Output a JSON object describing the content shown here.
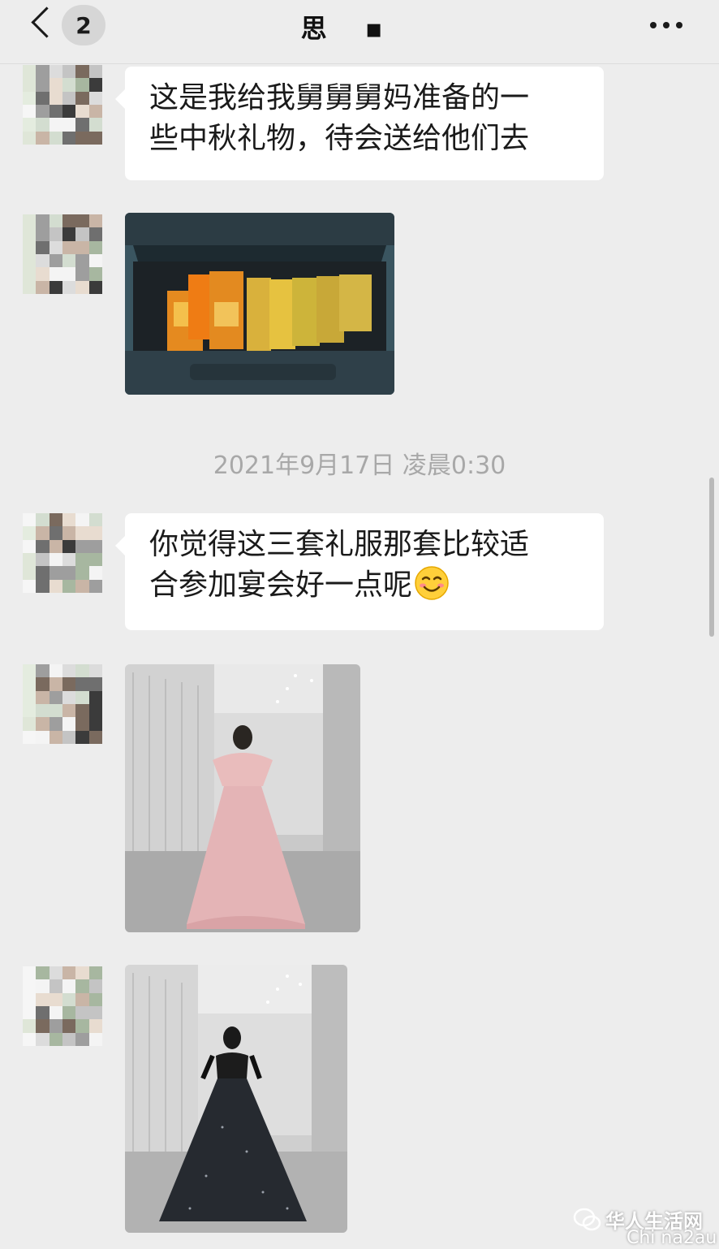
{
  "header": {
    "unread_count": "2",
    "title": "思 ▪"
  },
  "messages": {
    "m1": [
      "这是我给我舅舅舅妈准备的一",
      "些中秋礼物，待会送给他们去"
    ],
    "m4": [
      "你觉得这三套礼服那套比较适",
      "合参加宴会好一点呢"
    ]
  },
  "timestamp": "2021年9月17日 凌晨0:30",
  "watermark": {
    "name": "华人生活网",
    "site": "Chi na2au"
  },
  "icons": {
    "back": "chevron-left-icon",
    "more": "more-dots-icon",
    "emoji": "smile-emoji-icon"
  },
  "colors": {
    "background": "#ededed",
    "bubble": "#ffffff",
    "timestamp": "#a8a8a8"
  }
}
